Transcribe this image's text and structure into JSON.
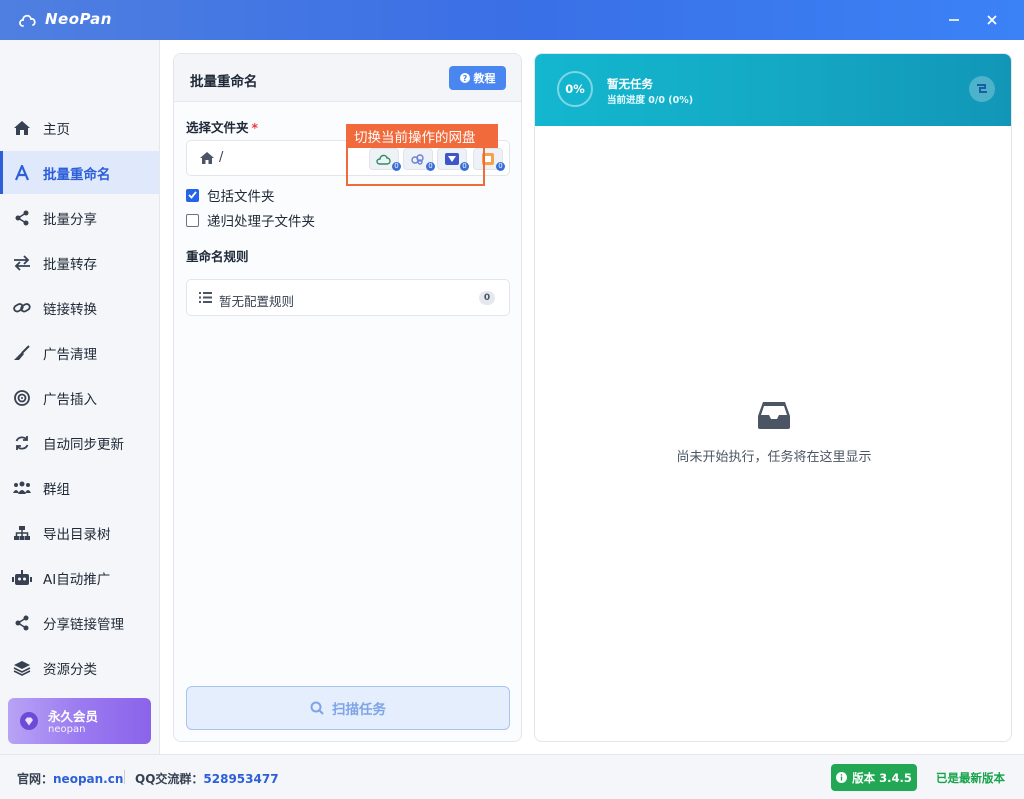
{
  "app": {
    "title": "NeoPan"
  },
  "sidebar": {
    "items": [
      {
        "label": "主页",
        "icon": "home-icon"
      },
      {
        "label": "批量重命名",
        "icon": "letter-a-icon",
        "active": true
      },
      {
        "label": "批量分享",
        "icon": "share-icon"
      },
      {
        "label": "批量转存",
        "icon": "transfer-icon"
      },
      {
        "label": "链接转换",
        "icon": "link-icon"
      },
      {
        "label": "广告清理",
        "icon": "broom-icon"
      },
      {
        "label": "广告插入",
        "icon": "target-icon"
      },
      {
        "label": "自动同步更新",
        "icon": "sync-icon"
      },
      {
        "label": "群组",
        "icon": "group-icon"
      },
      {
        "label": "导出目录树",
        "icon": "tree-icon"
      },
      {
        "label": "AI自动推广",
        "icon": "robot-icon"
      },
      {
        "label": "分享链接管理",
        "icon": "share-icon"
      },
      {
        "label": "资源分类",
        "icon": "layers-icon"
      }
    ],
    "member": {
      "title": "永久会员",
      "user": "neopan"
    }
  },
  "left_panel": {
    "title": "批量重命名",
    "tutorial_label": "教程",
    "folder_label": "选择文件夹",
    "required_mark": "*",
    "path": "/",
    "disk_badges": [
      "0",
      "0",
      "0",
      "0"
    ],
    "include_folders": "包括文件夹",
    "recursive": "递归处理子文件夹",
    "rules_label": "重命名规则",
    "rules_empty": "暂无配置规则",
    "rules_count": "0",
    "scan_label": "扫描任务"
  },
  "tooltip": {
    "text": "切换当前操作的网盘"
  },
  "right_panel": {
    "percent": "0%",
    "title": "暂无任务",
    "progress": "当前进度 0/0 (0%)",
    "empty_text": "尚未开始执行，任务将在这里显示"
  },
  "footer": {
    "site_label": "官网：",
    "site": "neopan.cn",
    "qq_label": "QQ交流群：",
    "qq": "528953477",
    "version_label": "版本 3.4.5",
    "latest": "已是最新版本"
  },
  "colors": {
    "brand": "#3a6fe6",
    "active_nav": "#2d5fd8",
    "progress_header": "#14a9c4",
    "tooltip": "#f06a3c",
    "version": "#22a855"
  }
}
